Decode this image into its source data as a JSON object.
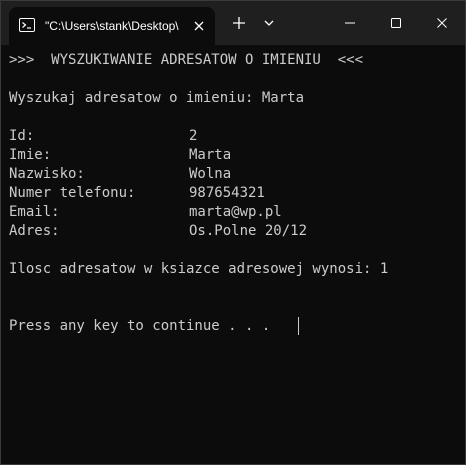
{
  "window": {
    "tab_title": "\"C:\\Users\\stank\\Desktop\\",
    "icons": {
      "app": "terminal-icon",
      "tab_close": "close-icon",
      "new_tab": "plus-icon",
      "dropdown": "chevron-down-icon",
      "minimize": "minimize-icon",
      "maximize": "maximize-icon",
      "close": "close-icon"
    }
  },
  "console": {
    "header": ">>>  WYSZUKIWANIE ADRESATOW O IMIENIU  <<<",
    "search_line": "Wyszukaj adresatow o imieniu: Marta",
    "record": [
      {
        "label": "Id:",
        "value": "2"
      },
      {
        "label": "Imie:",
        "value": "Marta"
      },
      {
        "label": "Nazwisko:",
        "value": "Wolna"
      },
      {
        "label": "Numer telefonu:",
        "value": "987654321"
      },
      {
        "label": "Email:",
        "value": "marta@wp.pl"
      },
      {
        "label": "Adres:",
        "value": "Os.Polne 20/12"
      }
    ],
    "count_line": "Ilosc adresatow w ksiazce adresowej wynosi: 1",
    "prompt_line": "Press any key to continue . . ."
  },
  "colors": {
    "console_bg": "#0c0c0c",
    "console_fg": "#cccccc",
    "titlebar_bg": "#1f1f1f"
  }
}
